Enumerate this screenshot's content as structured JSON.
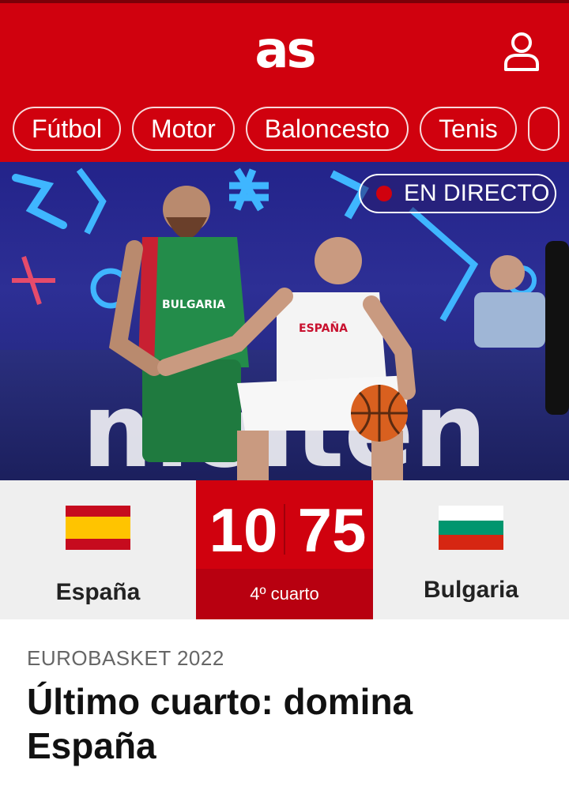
{
  "header": {
    "logo_text": "as",
    "user_icon": "user-icon",
    "brand_color": "#d0010e"
  },
  "nav": {
    "items": [
      {
        "label": "Fútbol"
      },
      {
        "label": "Motor"
      },
      {
        "label": "Baloncesto"
      },
      {
        "label": "Tenis"
      }
    ]
  },
  "hero": {
    "live_label": "EN DIRECTO",
    "player_left_jersey": "BULGARIA",
    "player_right_jersey": "ESPAÑA",
    "ad_board_text": "molten"
  },
  "match": {
    "home_team": "España",
    "away_team": "Bulgaria",
    "home_score": "10",
    "away_score": "75",
    "period": "4º cuarto",
    "home_flag": "spain-flag",
    "away_flag": "bulgaria-flag"
  },
  "article": {
    "kicker": "EUROBASKET 2022",
    "headline": "Último cuarto: domina España"
  }
}
